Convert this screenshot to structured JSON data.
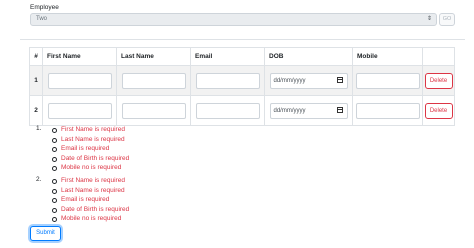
{
  "employee": {
    "label": "Employee",
    "selected": "Two",
    "go_label": "GO"
  },
  "table": {
    "headers": [
      "#",
      "First Name",
      "Last Name",
      "Email",
      "DOB",
      "Mobile",
      ""
    ],
    "rows": [
      {
        "index": "1",
        "first_name": "",
        "last_name": "",
        "email": "",
        "dob_placeholder": "dd/mm/yyyy",
        "mobile": "",
        "delete_label": "Delete"
      },
      {
        "index": "2",
        "first_name": "",
        "last_name": "",
        "email": "",
        "dob_placeholder": "dd/mm/yyyy",
        "mobile": "",
        "delete_label": "Delete"
      }
    ]
  },
  "errors": [
    {
      "number": "1.",
      "messages": [
        "First Name is required",
        "Last Name is required",
        "Email is required",
        "Date of Birth is required",
        "Mobile no is required"
      ]
    },
    {
      "number": "2.",
      "messages": [
        "First Name is required",
        "Last Name is required",
        "Email is required",
        "Date of Birth is required",
        "Mobile no is required"
      ]
    }
  ],
  "submit_label": "Submit",
  "colors": {
    "error": "#dc3545",
    "primary": "#007bff"
  }
}
